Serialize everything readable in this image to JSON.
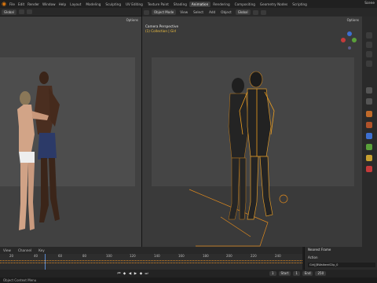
{
  "topbar": {
    "menus": [
      "File",
      "Edit",
      "Render",
      "Window",
      "Help"
    ],
    "workspaces": [
      "Layout",
      "Modeling",
      "Sculpting",
      "UV Editing",
      "Texture Paint",
      "Shading",
      "Animation",
      "Rendering",
      "Compositing",
      "Geometry Nodes",
      "Scripting"
    ],
    "active_workspace": "Animation",
    "scene": "Scene"
  },
  "left_view": {
    "orientation": "Global",
    "options": "Options"
  },
  "right_view": {
    "mode": "Object Mode",
    "menus": [
      "View",
      "Select",
      "Add",
      "Object"
    ],
    "orientation": "Global",
    "options": "Options",
    "camera_title": "Camera Perspective",
    "collection_label": "(1) Collection | Girl"
  },
  "timeline": {
    "menus": [
      "View",
      "Marker"
    ],
    "channel": "Channel",
    "key": "Key",
    "ticks": [
      "20",
      "40",
      "60",
      "80",
      "100",
      "120",
      "140",
      "160",
      "180",
      "200",
      "220",
      "240"
    ]
  },
  "action_panel": {
    "snap": "Nearest Frame",
    "action_label": "Action",
    "action_name": "Girl|[BWalkerdClip_0"
  },
  "playback": {
    "current_frame": "1",
    "start_label": "Start",
    "start": "1",
    "end_label": "End",
    "end": "250"
  },
  "status": {
    "text": "Object Context Menu"
  },
  "colors": {
    "accent": "#e87d0d",
    "selection": "#f0a020",
    "playhead": "#5a8ad0"
  }
}
